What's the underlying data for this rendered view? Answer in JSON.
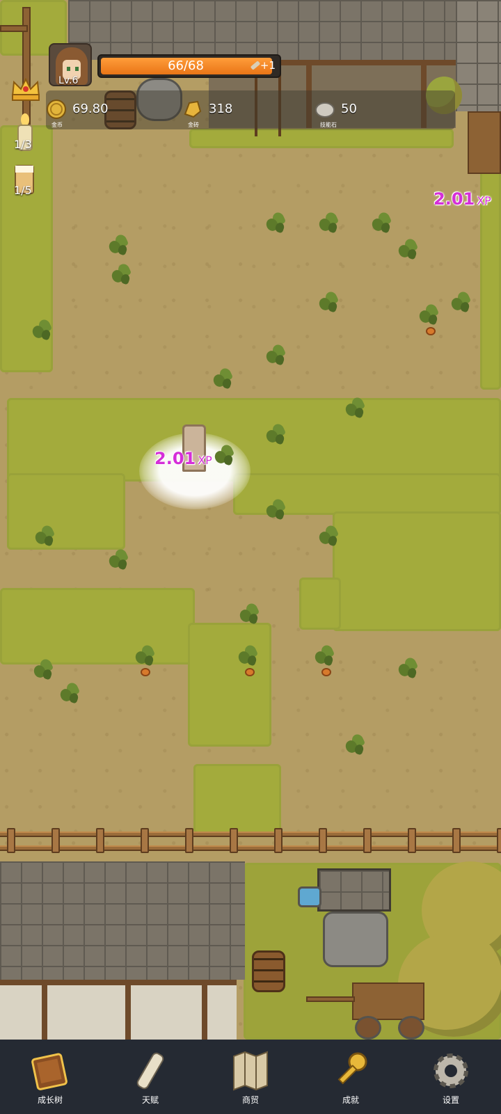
{
  "player": {
    "level": "Lv.6"
  },
  "xp_bar": {
    "text": "66/68",
    "plus": "+1",
    "progress": 0.97
  },
  "resources": [
    {
      "name": "gold-coin",
      "value": "69.80",
      "label": "金币",
      "icon": "coin-icon"
    },
    {
      "name": "gold-bar",
      "value": "318",
      "label": "金砖",
      "icon": "gold-bar-icon"
    },
    {
      "name": "skill-stone",
      "value": "50",
      "label": "技能石",
      "icon": "stone-icon"
    }
  ],
  "side_items": {
    "candle_count": "1/3",
    "beer_count": "1/5"
  },
  "xp_popups": [
    {
      "value": "2.01",
      "unit": "XP"
    },
    {
      "value": "2.01",
      "unit": "XP"
    }
  ],
  "nav": [
    {
      "label": "成长树",
      "icon": "book-icon"
    },
    {
      "label": "天赋",
      "icon": "scroll-icon"
    },
    {
      "label": "商贸",
      "icon": "map-icon"
    },
    {
      "label": "成就",
      "icon": "key-icon"
    },
    {
      "label": "设置",
      "icon": "gear-icon"
    }
  ],
  "colors": {
    "xp_popup": "#d52fd8",
    "xp_fill": "#e97517",
    "nav_bg": "#252a33"
  }
}
